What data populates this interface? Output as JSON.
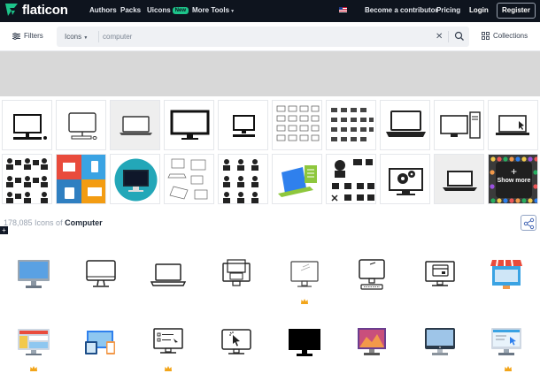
{
  "nav": {
    "logo_text": "flaticon",
    "items": [
      {
        "label": "Authors"
      },
      {
        "label": "Packs"
      },
      {
        "label": "Uicons",
        "badge": "New"
      },
      {
        "label": "More Tools"
      }
    ],
    "become_contributor": "Become a contributor",
    "pricing": "Pricing",
    "login": "Login",
    "register": "Register"
  },
  "search": {
    "filters_label": "Filters",
    "type_label": "Icons",
    "query": "computer",
    "collections_label": "Collections"
  },
  "thumbnails": {
    "show_more_label": "Show more"
  },
  "results": {
    "count": "178,085",
    "count_mid": " Icons of ",
    "keyword": "Computer"
  },
  "colors": {
    "topbar": "#0e141e",
    "new_badge": "#1dc48a",
    "premium_crown": "#f2a51a",
    "accent_blue": "#2f80ed"
  }
}
